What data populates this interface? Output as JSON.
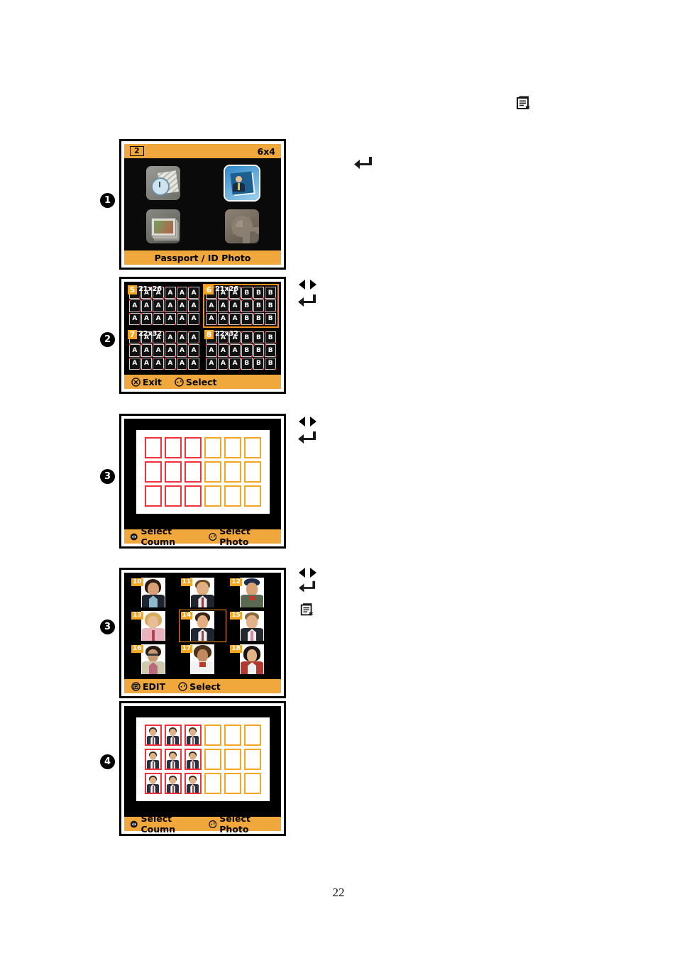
{
  "document": {
    "page_number": "22"
  },
  "steps": [
    {
      "number": "1"
    },
    {
      "number": "2"
    },
    {
      "number": "3"
    },
    {
      "number": "3"
    },
    {
      "number": "4"
    }
  ],
  "panel_home": {
    "copies_badge": "2",
    "paper_size": "6x4",
    "selected_label": "Passport / ID Photo",
    "tiles": [
      {
        "name": "copy-tile",
        "selected": "false"
      },
      {
        "name": "id-photo-tile",
        "selected": "true"
      },
      {
        "name": "print-photos-tile",
        "selected": "false"
      },
      {
        "name": "setup-tile",
        "selected": "false"
      }
    ]
  },
  "panel_sizes": {
    "quadrants": [
      {
        "number": "5",
        "size": "21x26",
        "left_label": "A",
        "right_label": "A",
        "selected": "false"
      },
      {
        "number": "6",
        "size": "21x26",
        "left_label": "A",
        "right_label": "B",
        "selected": "true"
      },
      {
        "number": "7",
        "size": "22x32",
        "left_label": "A",
        "right_label": "A",
        "selected": "false"
      },
      {
        "number": "8",
        "size": "22x32",
        "left_label": "A",
        "right_label": "B",
        "selected": "false"
      }
    ],
    "footer": {
      "exit_label": "Exit",
      "select_label": "Select"
    }
  },
  "panel_columns": {
    "columns": [
      "red",
      "red",
      "red",
      "orange",
      "orange",
      "orange"
    ],
    "rows": "3",
    "footer": {
      "column_label": "Select Coumn",
      "photo_label": "Select Photo"
    }
  },
  "panel_photos": {
    "items": [
      {
        "number": "10",
        "selected": "false"
      },
      {
        "number": "11",
        "selected": "false"
      },
      {
        "number": "12",
        "selected": "false"
      },
      {
        "number": "13",
        "selected": "false"
      },
      {
        "number": "14",
        "selected": "true"
      },
      {
        "number": "15",
        "selected": "false"
      },
      {
        "number": "16",
        "selected": "false"
      },
      {
        "number": "17",
        "selected": "false"
      },
      {
        "number": "18",
        "selected": "false"
      }
    ],
    "footer": {
      "edit_label": "EDIT",
      "select_label": "Select"
    }
  },
  "panel_result": {
    "columns": [
      "red",
      "red",
      "red",
      "orange",
      "orange",
      "orange"
    ],
    "filled_columns": "3",
    "rows": "3",
    "footer": {
      "column_label": "Select Coumn",
      "photo_label": "Select Photo"
    }
  },
  "key_icons": {
    "menu": "menu-document-icon",
    "enter": "enter-arrow-icon",
    "left": "left-arrow-icon",
    "right": "right-arrow-icon"
  },
  "colors": {
    "accent_orange": "#f0a73c",
    "badge_orange": "#f5a623",
    "highlight_orange": "#f2911d",
    "selection_red": "#f0323c",
    "screen_black": "#000000"
  }
}
